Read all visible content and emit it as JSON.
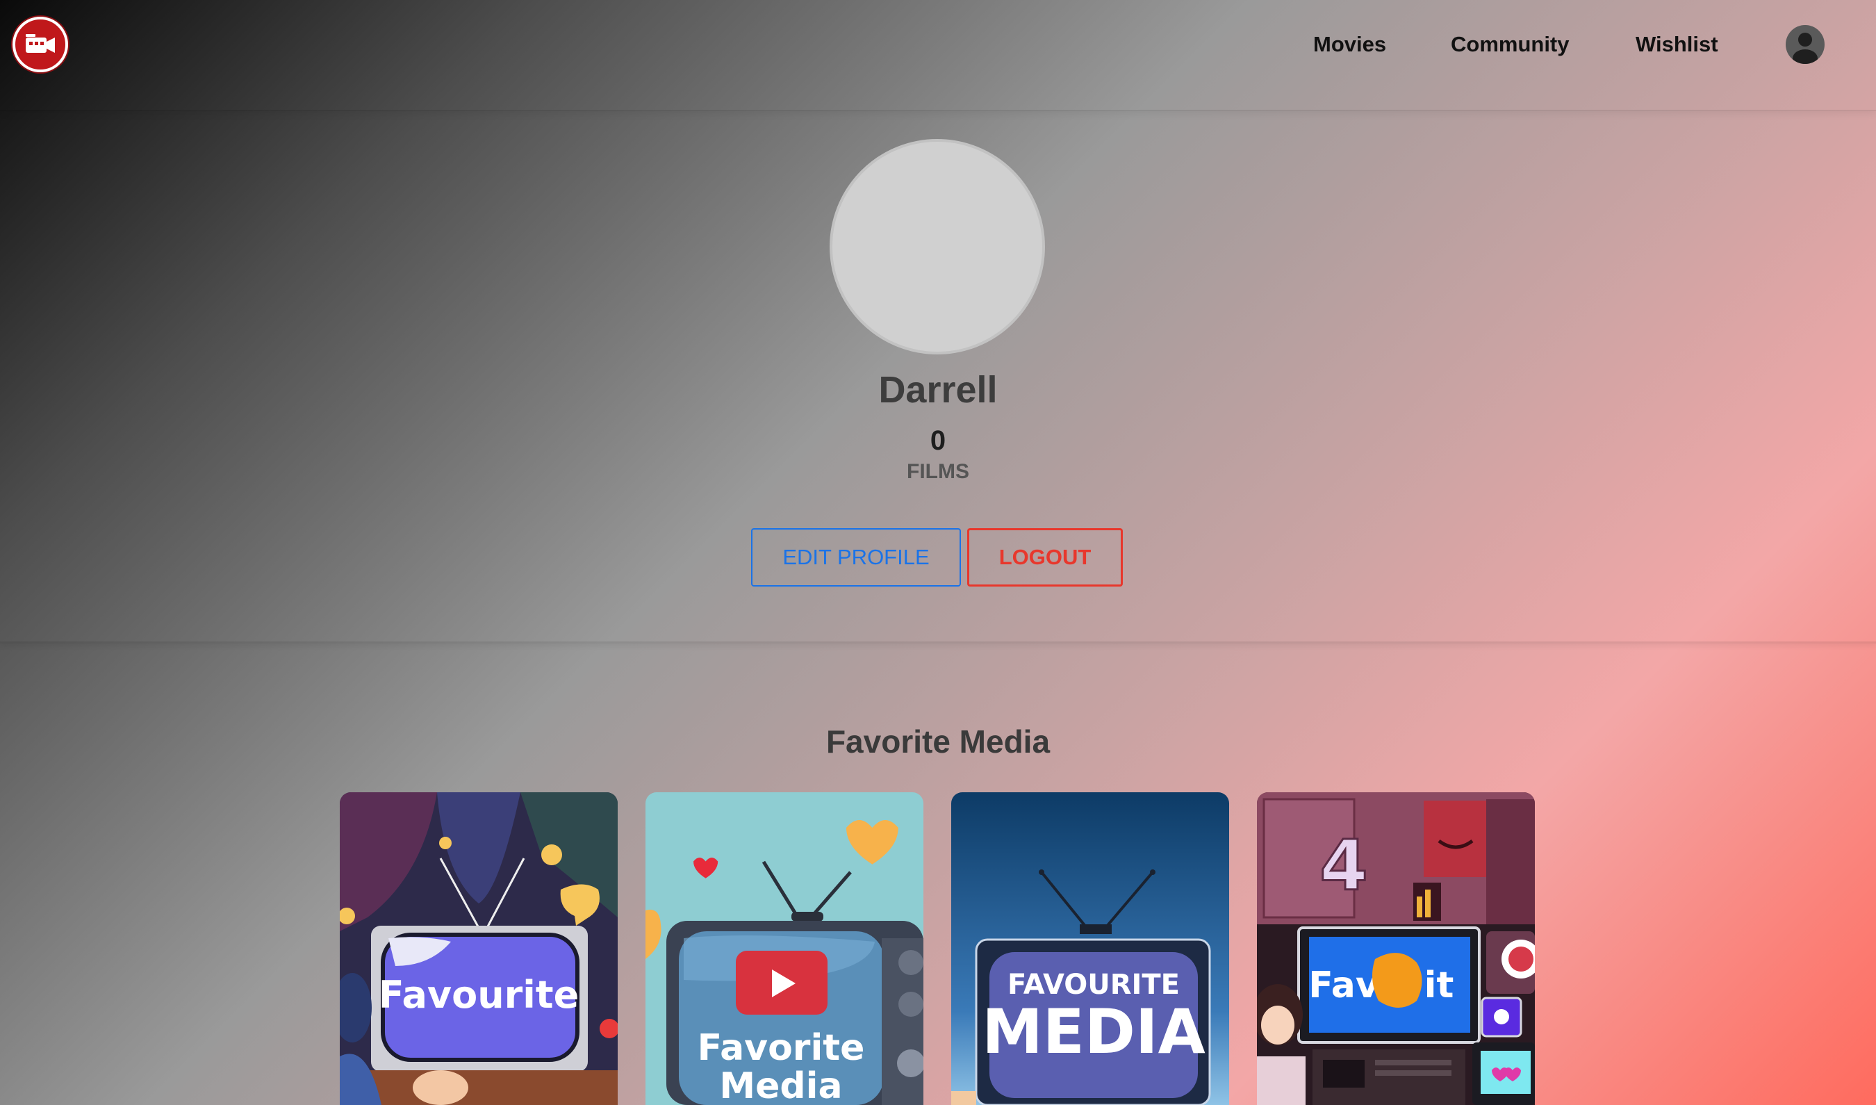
{
  "nav": {
    "logo_icon": "camera-icon",
    "links": [
      "Movies",
      "Community",
      "Wishlist"
    ],
    "account_icon": "user-account-icon"
  },
  "profile": {
    "name": "Darrell",
    "films_count": "0",
    "films_label": "FILMS",
    "edit_label": "EDIT PROFILE",
    "logout_label": "LOGOUT"
  },
  "favorites": {
    "title": "Favorite Media",
    "cards": [
      {
        "art_text": "Favourite"
      },
      {
        "art_text_line1": "Favorite",
        "art_text_line2": "Media"
      },
      {
        "art_text_line1": "FAVOURITE",
        "art_text_line2": "MEDIA"
      },
      {
        "art_text_a": "Fav",
        "art_text_b": "it",
        "art_number": "4"
      }
    ]
  },
  "colors": {
    "edit_button": "#1a73e8",
    "logout_button": "#e8372c",
    "logo_red": "#c0181b"
  }
}
